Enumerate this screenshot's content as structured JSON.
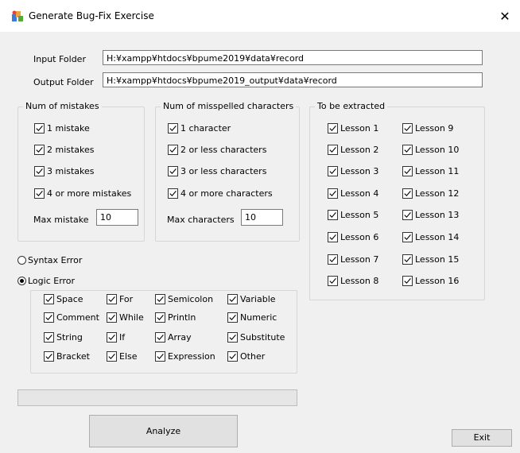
{
  "window": {
    "title": "Generate Bug-Fix Exercise"
  },
  "folders": {
    "input_label": "Input Folder",
    "input_value": "H:¥xampp¥htdocs¥bpume2019¥data¥record",
    "output_label": "Output Folder",
    "output_value": "H:¥xampp¥htdocs¥bpume2019_output¥data¥record"
  },
  "mistakes_group": {
    "title": "Num of mistakes",
    "options": [
      {
        "label": "1 mistake",
        "checked": true
      },
      {
        "label": "2 mistakes",
        "checked": true
      },
      {
        "label": "3 mistakes",
        "checked": true
      },
      {
        "label": "4 or more mistakes",
        "checked": true
      }
    ],
    "max_label": "Max mistake",
    "max_value": "10"
  },
  "misspelled_group": {
    "title": "Num of misspelled characters",
    "options": [
      {
        "label": "1 character",
        "checked": true
      },
      {
        "label": "2 or less characters",
        "checked": true
      },
      {
        "label": "3 or less characters",
        "checked": true
      },
      {
        "label": "4 or more characters",
        "checked": true
      }
    ],
    "max_label": "Max  characters",
    "max_value": "10"
  },
  "extract_group": {
    "title": "To be extracted",
    "lessons": [
      {
        "label": "Lesson 1",
        "checked": true
      },
      {
        "label": "Lesson 2",
        "checked": true
      },
      {
        "label": "Lesson 3",
        "checked": true
      },
      {
        "label": "Lesson 4",
        "checked": true
      },
      {
        "label": "Lesson 5",
        "checked": true
      },
      {
        "label": "Lesson 6",
        "checked": true
      },
      {
        "label": "Lesson 7",
        "checked": true
      },
      {
        "label": "Lesson 8",
        "checked": true
      },
      {
        "label": "Lesson 9",
        "checked": true
      },
      {
        "label": "Lesson 10",
        "checked": true
      },
      {
        "label": "Lesson 11",
        "checked": true
      },
      {
        "label": "Lesson 12",
        "checked": true
      },
      {
        "label": "Lesson 13",
        "checked": true
      },
      {
        "label": "Lesson 14",
        "checked": true
      },
      {
        "label": "Lesson 15",
        "checked": true
      },
      {
        "label": "Lesson 16",
        "checked": true
      }
    ]
  },
  "error_type": {
    "syntax_label": "Syntax Error",
    "logic_label": "Logic Error",
    "selected": "logic"
  },
  "logic_options": [
    {
      "label": "Space",
      "checked": true
    },
    {
      "label": "For",
      "checked": true
    },
    {
      "label": "Semicolon",
      "checked": true
    },
    {
      "label": "Variable",
      "checked": true
    },
    {
      "label": "Comment",
      "checked": true
    },
    {
      "label": "While",
      "checked": true
    },
    {
      "label": "Println",
      "checked": true
    },
    {
      "label": "Numeric",
      "checked": true
    },
    {
      "label": "String",
      "checked": true
    },
    {
      "label": "If",
      "checked": true
    },
    {
      "label": "Array",
      "checked": true
    },
    {
      "label": "Substitute",
      "checked": true
    },
    {
      "label": "Bracket",
      "checked": true
    },
    {
      "label": "Else",
      "checked": true
    },
    {
      "label": "Expression",
      "checked": true
    },
    {
      "label": "Other",
      "checked": true
    }
  ],
  "progress": {
    "value": 0
  },
  "buttons": {
    "analyze": "Analyze",
    "exit": "Exit"
  },
  "icons": {
    "title": "app-icon",
    "close": "close-icon",
    "check": "checkmark-icon"
  }
}
